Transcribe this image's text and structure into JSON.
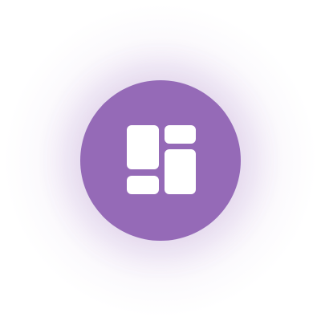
{
  "icon": {
    "name": "dashboard-layout-icon",
    "background_color": "#956ab7",
    "glyph_color": "#ffffff"
  }
}
